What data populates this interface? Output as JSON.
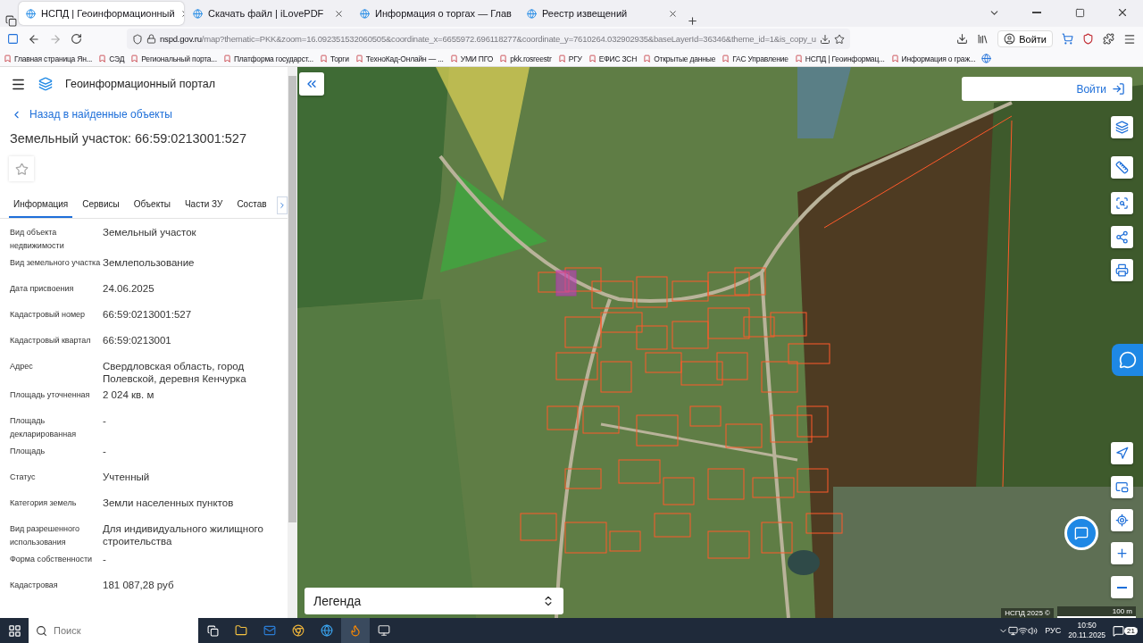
{
  "browser": {
    "tabs": [
      {
        "title": "НСПД | Геоинформационный",
        "selected": true
      },
      {
        "title": "Скачать файл | iLovePDF",
        "selected": false
      },
      {
        "title": "Информация о торгах — Глав",
        "selected": false
      },
      {
        "title": "Реестр извещений",
        "selected": false
      }
    ],
    "address": {
      "host": "nspd.gov.ru",
      "path": "/map?thematic=PKK&zoom=16.092351532060505&coordinate_x=6655972.696118277&coordinate_y=7610264.032902935&baseLayerId=36346&theme_id=1&is_copy_u"
    },
    "login": "Войти",
    "bookmarks": [
      "Главная страница Ян...",
      "СЭД",
      "Региональный порта...",
      "Платформа государст...",
      "Торги",
      "ТехноКад-Онлайн — ...",
      "УМИ ПГО",
      "pkk.rosreestr",
      "РГУ",
      "ЕФИС ЗСН",
      "Открытые данные",
      "ГАС Управление",
      "НСПД | Геоинформац...",
      "Информация о граж..."
    ]
  },
  "panel": {
    "portal_title": "Геоинформационный портал",
    "back_link": "Назад в найденные объекты",
    "title": "Земельный участок: 66:59:0213001:527",
    "tabs": [
      {
        "label": "Информация",
        "selected": true
      },
      {
        "label": "Сервисы",
        "selected": false
      },
      {
        "label": "Объекты",
        "selected": false
      },
      {
        "label": "Части ЗУ",
        "selected": false
      },
      {
        "label": "Состав",
        "selected": false
      }
    ],
    "fields": [
      {
        "label": "Вид объекта недвижимости",
        "value": "Земельный участок"
      },
      {
        "label": "Вид земельного участка",
        "value": "Землепользование"
      },
      {
        "label": "Дата присвоения",
        "value": "24.06.2025"
      },
      {
        "label": "Кадастровый номер",
        "value": "66:59:0213001:527"
      },
      {
        "label": "Кадастровый квартал",
        "value": "66:59:0213001"
      },
      {
        "label": "Адрес",
        "value": "Свердловская область, город Полевской, деревня Кенчурка"
      },
      {
        "label": "Площадь уточненная",
        "value": "2 024 кв. м"
      },
      {
        "label": "Площадь декларированная",
        "value": "-"
      },
      {
        "label": "Площадь",
        "value": "-"
      },
      {
        "label": "Статус",
        "value": "Учтенный"
      },
      {
        "label": "Категория земель",
        "value": "Земли населенных пунктов"
      },
      {
        "label": "Вид разрешенного использования",
        "value": "Для индивидуального жилищного строительства"
      },
      {
        "label": "Форма собственности",
        "value": "-"
      },
      {
        "label": "Кадастровая",
        "value": "181 087,28 руб"
      }
    ]
  },
  "map": {
    "login": "Войти",
    "legend": "Легенда",
    "copyright": "НСПД 2025 ©",
    "scale": "100 m"
  },
  "taskbar": {
    "search_placeholder": "Поиск",
    "language": "РУС",
    "time": "10:50",
    "date": "20.11.2025",
    "notifications": "21"
  }
}
